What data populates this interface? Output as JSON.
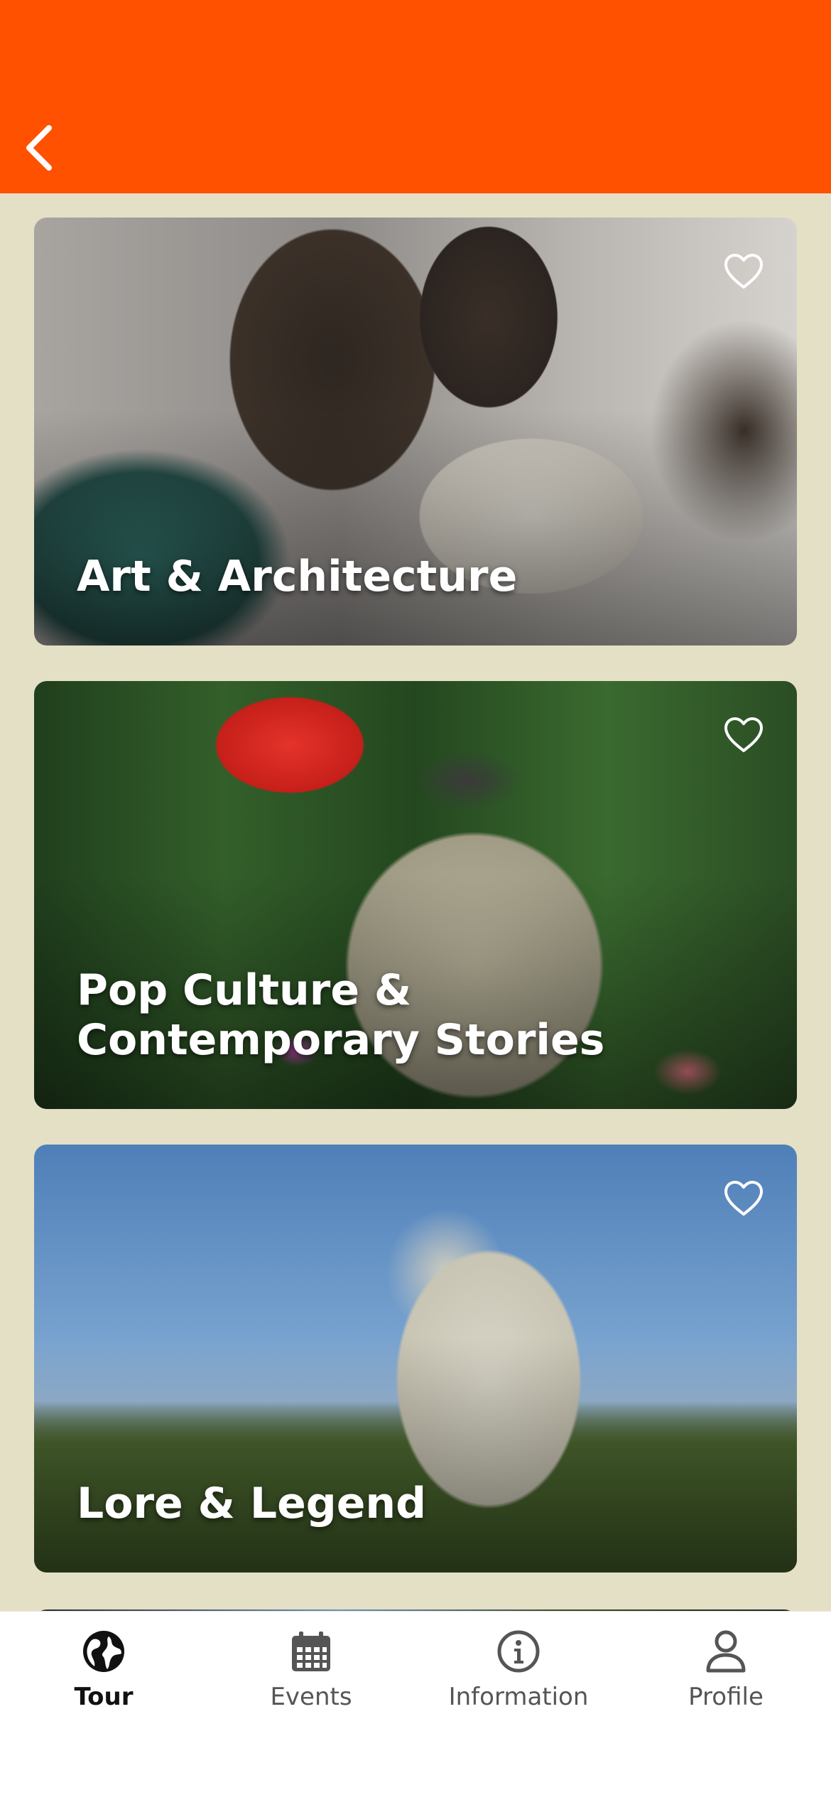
{
  "header": {
    "back_icon": "chevron-left-icon",
    "background_color": "#ff5100"
  },
  "cards": [
    {
      "title": "Art & Architecture",
      "favorite_icon": "heart-outline-icon",
      "favorited": false
    },
    {
      "title": "Pop Culture & Contemporary Stories",
      "favorite_icon": "heart-outline-icon",
      "favorited": false
    },
    {
      "title": "Lore & Legend",
      "favorite_icon": "heart-outline-icon",
      "favorited": false
    }
  ],
  "tabs": [
    {
      "label": "Tour",
      "icon": "globe-icon",
      "active": true
    },
    {
      "label": "Events",
      "icon": "calendar-icon",
      "active": false
    },
    {
      "label": "Information",
      "icon": "info-icon",
      "active": false
    },
    {
      "label": "Profile",
      "icon": "person-icon",
      "active": false
    }
  ],
  "colors": {
    "page_background": "#e4e0c6",
    "tab_active": "#111111",
    "tab_inactive": "#555555"
  }
}
